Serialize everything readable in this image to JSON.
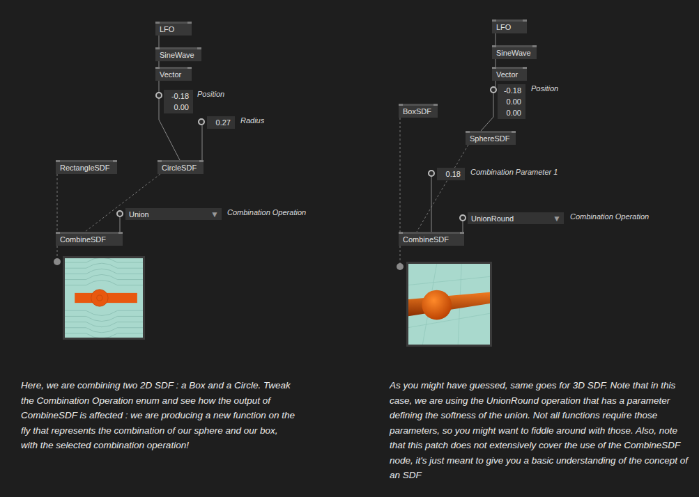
{
  "patches": [
    {
      "nodes": [
        {
          "label": "LFO"
        },
        {
          "label": "SineWave"
        },
        {
          "label": "Vector"
        },
        {
          "label": "RectangleSDF"
        },
        {
          "label": "CircleSDF"
        },
        {
          "label": "CombineSDF"
        }
      ],
      "ioboxes": [
        {
          "values": [
            "-0.18",
            "0.00"
          ],
          "label": "Position"
        },
        {
          "values": [
            "0.27"
          ],
          "label": "Radius"
        }
      ],
      "dropdown": {
        "value": "Union",
        "arrow": "▼",
        "label": "Combination Operation"
      },
      "preview": {
        "kind": "2d"
      },
      "description": "Here, we are combining two 2D SDF : a Box and a Circle. Tweak the Combination Operation enum and see how the output of CombineSDF is affected : we are producing a new function on the fly that represents the combination of our sphere and our box, with the selected combination operation!"
    },
    {
      "nodes": [
        {
          "label": "LFO"
        },
        {
          "label": "SineWave"
        },
        {
          "label": "Vector"
        },
        {
          "label": "BoxSDF"
        },
        {
          "label": "SphereSDF"
        },
        {
          "label": "CombineSDF"
        }
      ],
      "ioboxes": [
        {
          "values": [
            "-0.18",
            "0.00",
            "0.00"
          ],
          "label": "Position"
        },
        {
          "values": [
            "0.18"
          ],
          "label": "Combination Parameter 1"
        }
      ],
      "dropdown": {
        "value": "UnionRound",
        "arrow": "▼",
        "label": "Combination Operation"
      },
      "preview": {
        "kind": "3d"
      },
      "description": "As you might have guessed, same goes for 3D SDF. Note that in this case, we are using the UnionRound operation that has a parameter defining the softness of the union. Not all functions require those parameters, so you might want to fiddle around with those. Also, note that this patch does not extensively cover the use of the CombineSDF node, it's just meant to give you a basic understanding of the concept of an SDF"
    }
  ]
}
